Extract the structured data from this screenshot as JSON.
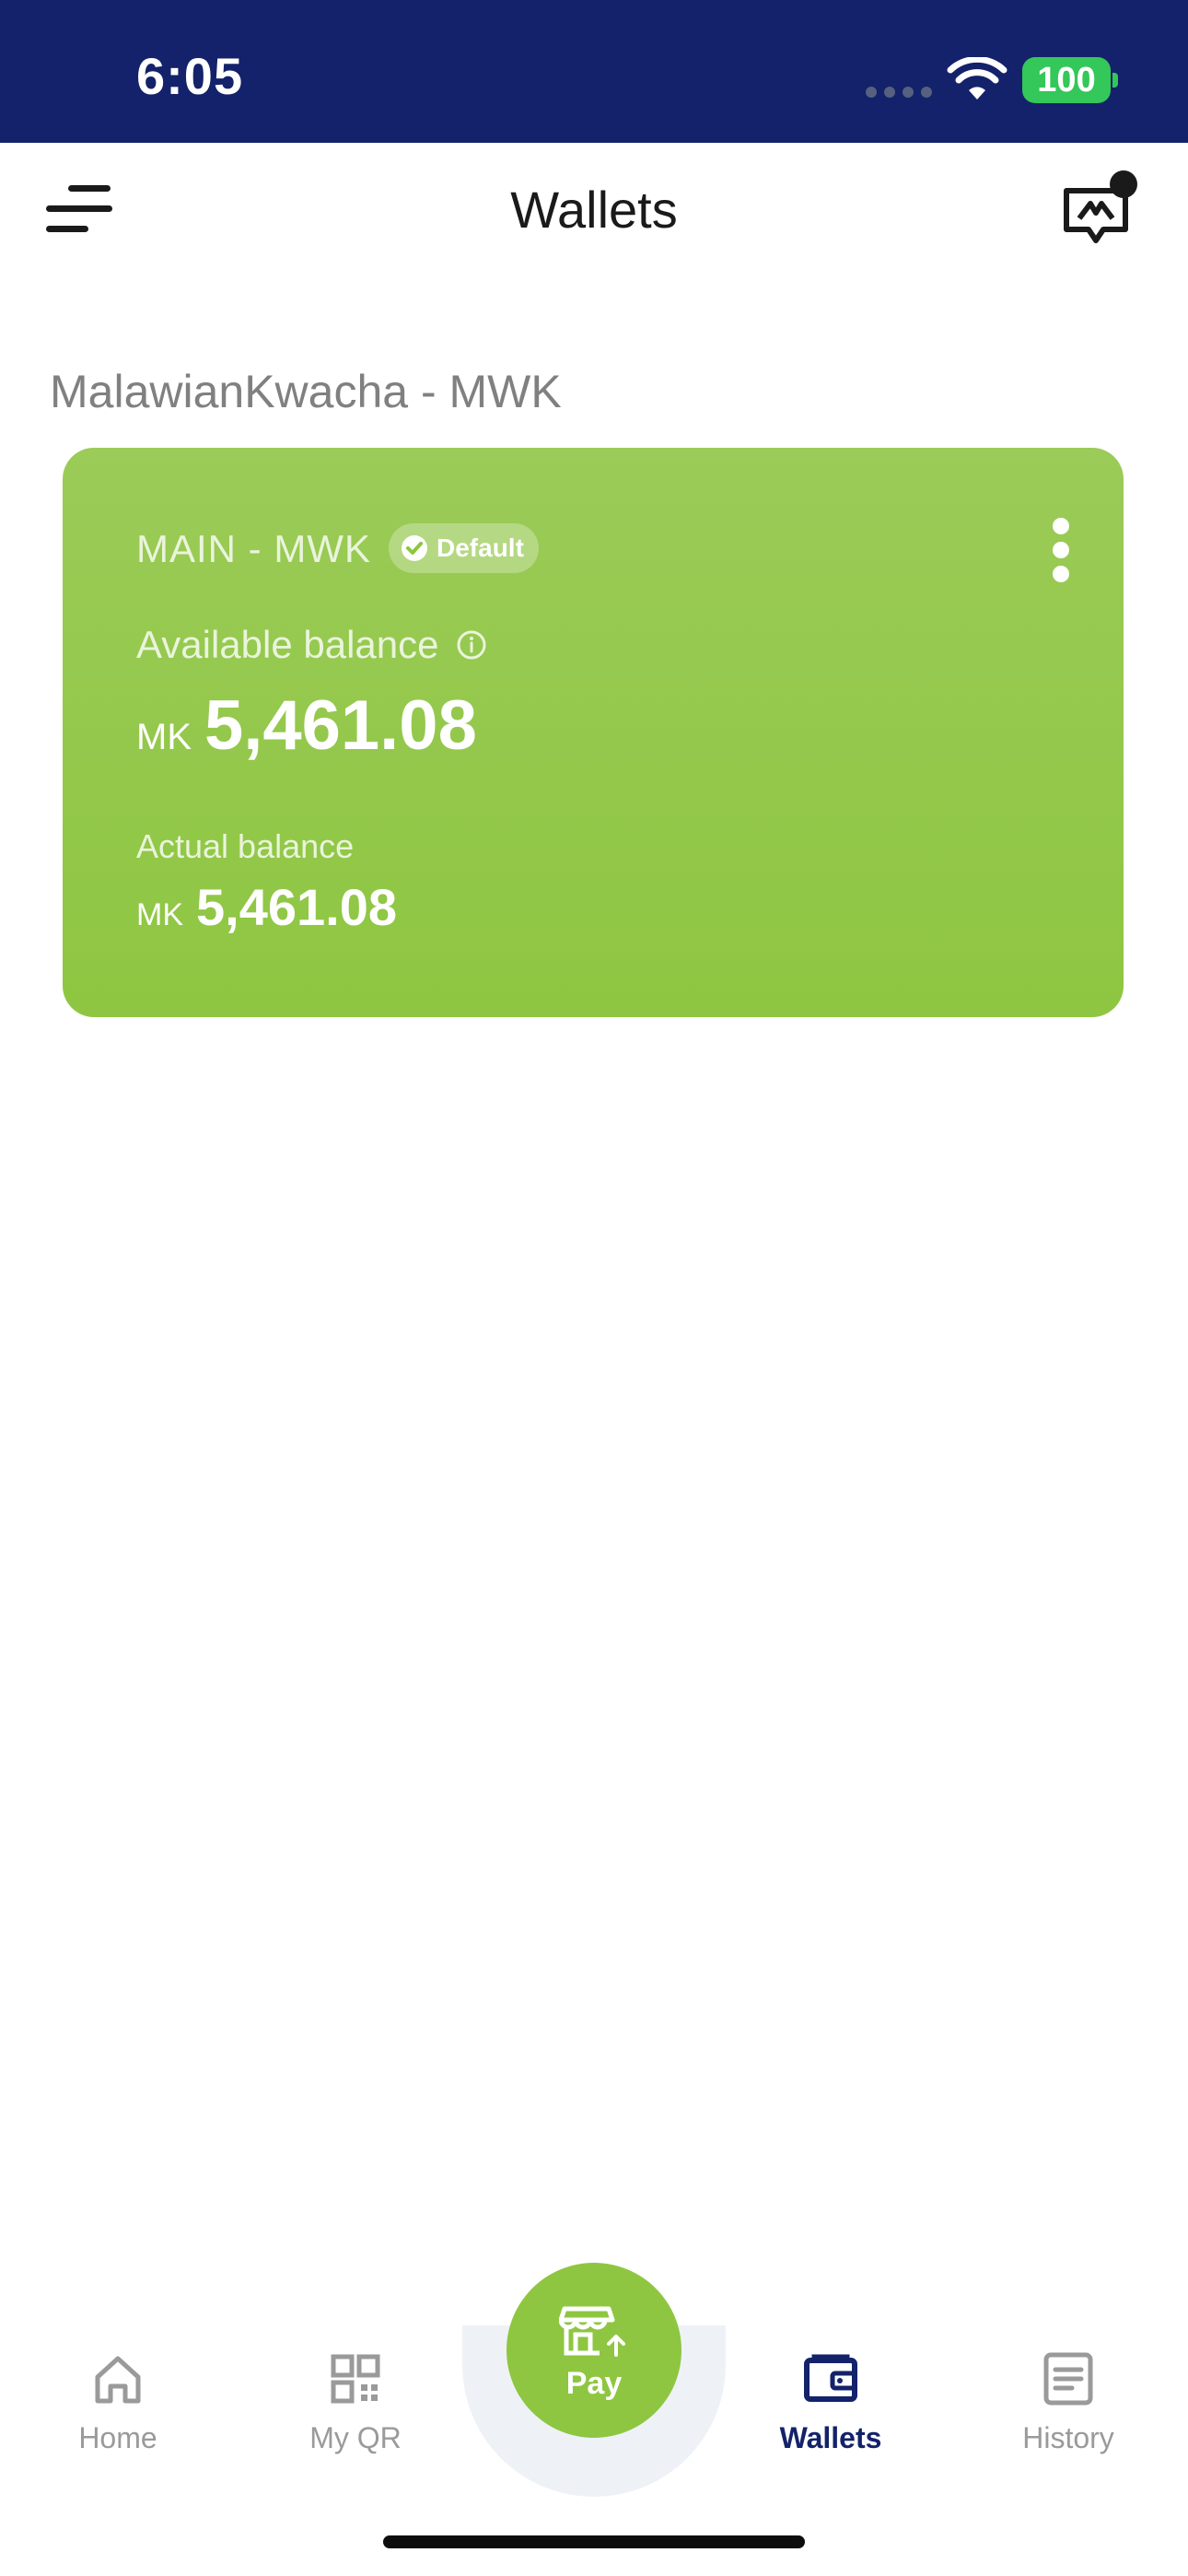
{
  "status_bar": {
    "time": "6:05",
    "battery": "100"
  },
  "header": {
    "title": "Wallets",
    "menu_icon": "hamburger-menu-icon",
    "chat_icon": "chat-support-icon"
  },
  "section": {
    "currency_heading": "MalawianKwacha - MWK"
  },
  "wallet_card": {
    "name": "MAIN - MWK",
    "badge": "Default",
    "available_label": "Available balance",
    "available_currency": "MK",
    "available_amount": "5,461.08",
    "actual_label": "Actual balance",
    "actual_currency": "MK",
    "actual_amount": "5,461.08",
    "card_color": "#8ec641"
  },
  "bottom_nav": {
    "items": [
      {
        "label": "Home",
        "icon": "home-icon"
      },
      {
        "label": "My QR",
        "icon": "qr-code-icon"
      },
      {
        "label": "Pay",
        "icon": "store-pay-icon"
      },
      {
        "label": "Wallets",
        "icon": "wallet-icon",
        "active": true
      },
      {
        "label": "History",
        "icon": "history-list-icon"
      }
    ],
    "active_color": "#13226a",
    "inactive_color": "#9a9a9a"
  }
}
